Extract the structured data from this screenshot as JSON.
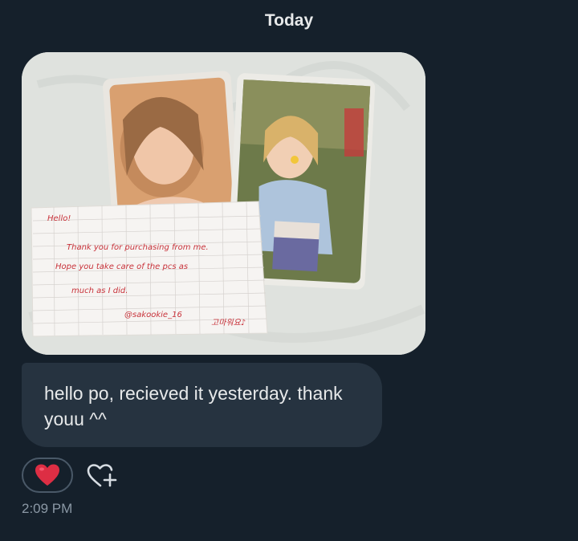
{
  "thread": {
    "day_label": "Today"
  },
  "attachment": {
    "note_lines": [
      "Hello!",
      "Thank you for purchasing from me.",
      "Hope you take care of the pcs as",
      "much as I did.",
      "@sakookie_16"
    ],
    "note_signature": "고마워요♪"
  },
  "message": {
    "text": "hello po, recieved it yesterday. thank youu ^^",
    "time": "2:09 PM"
  },
  "reactions": {
    "selected_emoji": "❤️",
    "add_icon": "heart-plus-icon"
  },
  "colors": {
    "background": "#15202b",
    "bubble": "#263340",
    "text": "#e7e9ea",
    "muted": "#8b98a5",
    "heart": "#e0245e"
  }
}
